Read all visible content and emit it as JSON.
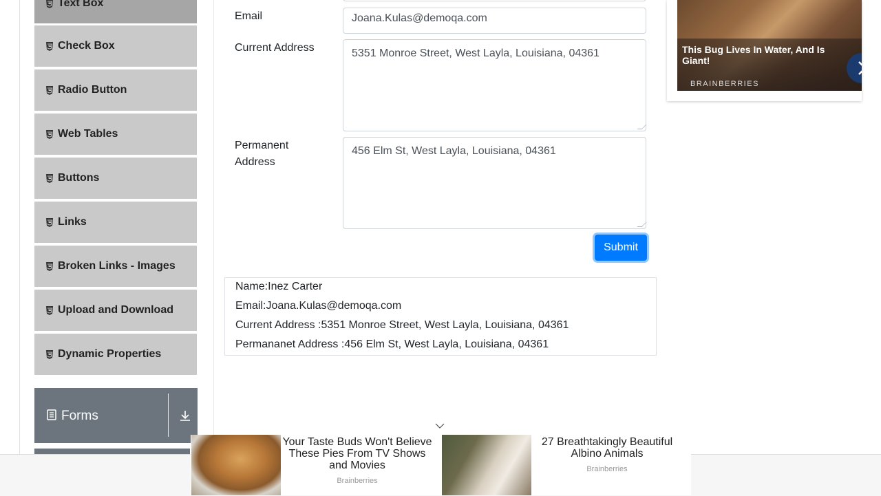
{
  "sidebar": {
    "items": [
      {
        "label": "Text Box"
      },
      {
        "label": "Check Box"
      },
      {
        "label": "Radio Button"
      },
      {
        "label": "Web Tables"
      },
      {
        "label": "Buttons"
      },
      {
        "label": "Links"
      },
      {
        "label": "Broken Links - Images"
      },
      {
        "label": "Upload and Download"
      },
      {
        "label": "Dynamic Properties"
      }
    ],
    "group": {
      "label": "Forms",
      "icon": "document-icon",
      "toggle_icon": "download-arrow-icon"
    }
  },
  "form": {
    "email_label": "Email",
    "email_value": "Joana.Kulas@demoqa.com",
    "current_address_label": "Current Address",
    "current_address_value": "5351 Monroe Street, West Layla, Louisiana, 04361",
    "permanent_address_label_line1": "Permanent",
    "permanent_address_label_line2": "Address",
    "permanent_address_value": "456 Elm St, West Layla, Louisiana, 04361",
    "submit_label": "Submit"
  },
  "output": {
    "name": "Name:Inez Carter",
    "email": "Email:Joana.Kulas@demoqa.com",
    "current_address": "Current Address :5351 Monroe Street, West Layla, Louisiana, 04361",
    "permanent_address": "Permananet Address :456 Elm St, West Layla, Louisiana, 04361"
  },
  "side_ad": {
    "headline": "This Bug Lives In Water, And Is Giant!",
    "brand": "BRAINBERRIES"
  },
  "bottom_ad": {
    "item1_title": "Your Taste Buds Won't Believe These Pies From TV Shows and Movies",
    "item1_source": "Brainberries",
    "item2_title": "27 Breathtakingly Beautiful Albino Animals",
    "item2_source": "Brainberries"
  },
  "colors": {
    "primary": "#007bff",
    "sidebar_item_bg": "#c9c9c9",
    "group_header_bg": "#6c757d"
  }
}
